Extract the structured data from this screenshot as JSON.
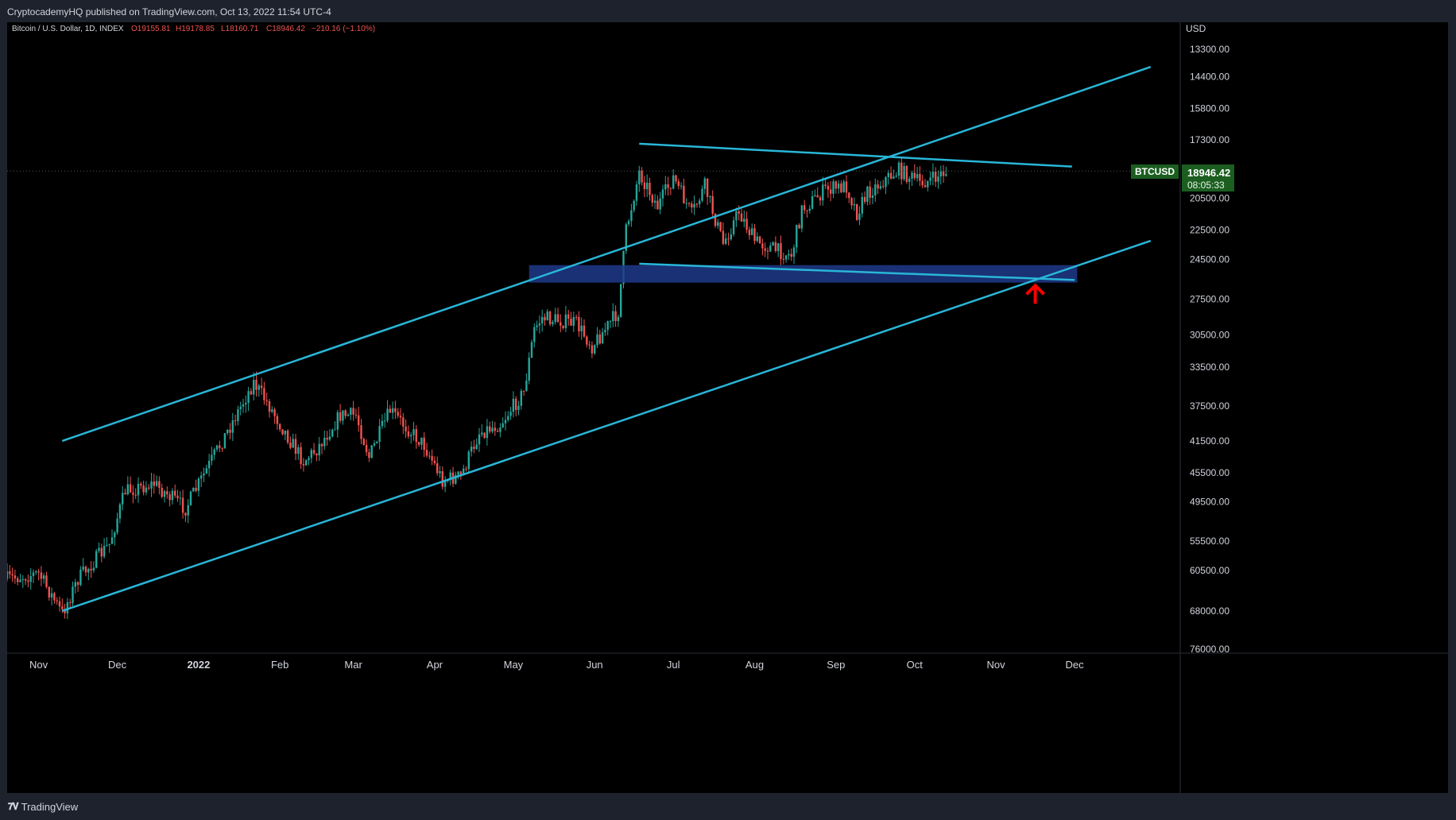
{
  "header": {
    "publisher": "CryptocademyHQ published on TradingView.com, Oct 13, 2022 11:54 UTC-4"
  },
  "footer": {
    "brand": "TradingView",
    "logo_glyph": "𝟕𝐕"
  },
  "symbol": {
    "name": "Bitcoin / U.S. Dollar, 1D, INDEX",
    "open": "O19155.81",
    "high": "H19178.85",
    "low": "L18160.71",
    "close": "C18946.42",
    "change": "−210.16 (−1.10%)",
    "ticker": "BTCUSD",
    "last_price": "18946.42",
    "countdown": "08:05:33",
    "colors": {
      "up": "#26a69a",
      "down": "#ef5350",
      "label_bg": "#1b5e20",
      "trendline": "#29b6d8",
      "zone": "#1e3a8a",
      "arrow": "#ff0000"
    }
  },
  "chart_data": {
    "type": "candlestick",
    "title": "Bitcoin / U.S. Dollar, 1D, INDEX",
    "currency": "USD",
    "y_scale": "log-inverted",
    "y_ticks": [
      "13300.00",
      "14400.00",
      "15800.00",
      "17300.00",
      "20500.00",
      "22500.00",
      "24500.00",
      "27500.00",
      "30500.00",
      "33500.00",
      "37500.00",
      "41500.00",
      "45500.00",
      "49500.00",
      "55500.00",
      "60500.00",
      "68000.00",
      "76000.00"
    ],
    "x_ticks": [
      "Nov",
      "Dec",
      "2022",
      "Feb",
      "Mar",
      "Apr",
      "May",
      "Jun",
      "Jul",
      "Aug",
      "Sep",
      "Oct",
      "Nov",
      "Dec"
    ],
    "x_ticks_bold": [
      "2022"
    ],
    "x_range": [
      "2021-10-20",
      "2022-12-20"
    ],
    "anchors": [
      {
        "date": "2021-10-20",
        "price": 62000
      },
      {
        "date": "2021-11-01",
        "price": 61000
      },
      {
        "date": "2021-11-10",
        "price": 68500
      },
      {
        "date": "2021-11-16",
        "price": 62000
      },
      {
        "date": "2021-11-28",
        "price": 56000
      },
      {
        "date": "2021-12-04",
        "price": 48000
      },
      {
        "date": "2021-12-15",
        "price": 47000
      },
      {
        "date": "2021-12-27",
        "price": 50500
      },
      {
        "date": "2022-01-10",
        "price": 41500
      },
      {
        "date": "2022-01-22",
        "price": 35000
      },
      {
        "date": "2022-01-28",
        "price": 37500
      },
      {
        "date": "2022-02-05",
        "price": 41500
      },
      {
        "date": "2022-02-10",
        "price": 44000
      },
      {
        "date": "2022-02-15",
        "price": 42500
      },
      {
        "date": "2022-02-24",
        "price": 38500
      },
      {
        "date": "2022-03-02",
        "price": 38500
      },
      {
        "date": "2022-03-07",
        "price": 43500
      },
      {
        "date": "2022-03-15",
        "price": 38000
      },
      {
        "date": "2022-03-28",
        "price": 42000
      },
      {
        "date": "2022-04-04",
        "price": 46500
      },
      {
        "date": "2022-04-11",
        "price": 46000
      },
      {
        "date": "2022-04-18",
        "price": 40500
      },
      {
        "date": "2022-04-26",
        "price": 39500
      },
      {
        "date": "2022-05-05",
        "price": 36000
      },
      {
        "date": "2022-05-09",
        "price": 30000
      },
      {
        "date": "2022-05-12",
        "price": 29000
      },
      {
        "date": "2022-05-25",
        "price": 29500
      },
      {
        "date": "2022-05-31",
        "price": 31500
      },
      {
        "date": "2022-06-05",
        "price": 30000
      },
      {
        "date": "2022-06-10",
        "price": 28500
      },
      {
        "date": "2022-06-13",
        "price": 22500
      },
      {
        "date": "2022-06-18",
        "price": 19000
      },
      {
        "date": "2022-06-25",
        "price": 21000
      },
      {
        "date": "2022-07-01",
        "price": 19300
      },
      {
        "date": "2022-07-08",
        "price": 21500
      },
      {
        "date": "2022-07-13",
        "price": 19800
      },
      {
        "date": "2022-07-20",
        "price": 23400
      },
      {
        "date": "2022-07-26",
        "price": 21300
      },
      {
        "date": "2022-08-01",
        "price": 23200
      },
      {
        "date": "2022-08-10",
        "price": 23900
      },
      {
        "date": "2022-08-15",
        "price": 24200
      },
      {
        "date": "2022-08-19",
        "price": 21200
      },
      {
        "date": "2022-08-28",
        "price": 20000
      },
      {
        "date": "2022-09-05",
        "price": 19800
      },
      {
        "date": "2022-09-09",
        "price": 21400
      },
      {
        "date": "2022-09-13",
        "price": 20200
      },
      {
        "date": "2022-09-19",
        "price": 19500
      },
      {
        "date": "2022-09-25",
        "price": 18900
      },
      {
        "date": "2022-10-03",
        "price": 19600
      },
      {
        "date": "2022-10-08",
        "price": 19400
      },
      {
        "date": "2022-10-13",
        "price": 18946
      }
    ],
    "drawings": {
      "channel_upper": [
        {
          "date": "2021-11-10",
          "price": 41500
        },
        {
          "date": "2022-12-30",
          "price": 14000
        }
      ],
      "channel_lower": [
        {
          "date": "2021-11-10",
          "price": 68000
        },
        {
          "date": "2022-12-30",
          "price": 23200
        }
      ],
      "triangle_top": [
        {
          "date": "2022-06-18",
          "price": 17500
        },
        {
          "date": "2022-11-30",
          "price": 18700
        }
      ],
      "triangle_bottom": [
        {
          "date": "2022-06-18",
          "price": 24800
        },
        {
          "date": "2022-12-01",
          "price": 26000
        }
      ],
      "zone": {
        "from": "2022-05-07",
        "to": "2022-12-02",
        "top": 24900,
        "bottom": 26200
      },
      "arrow": {
        "date": "2022-11-16",
        "price_tip": 26300
      }
    }
  }
}
